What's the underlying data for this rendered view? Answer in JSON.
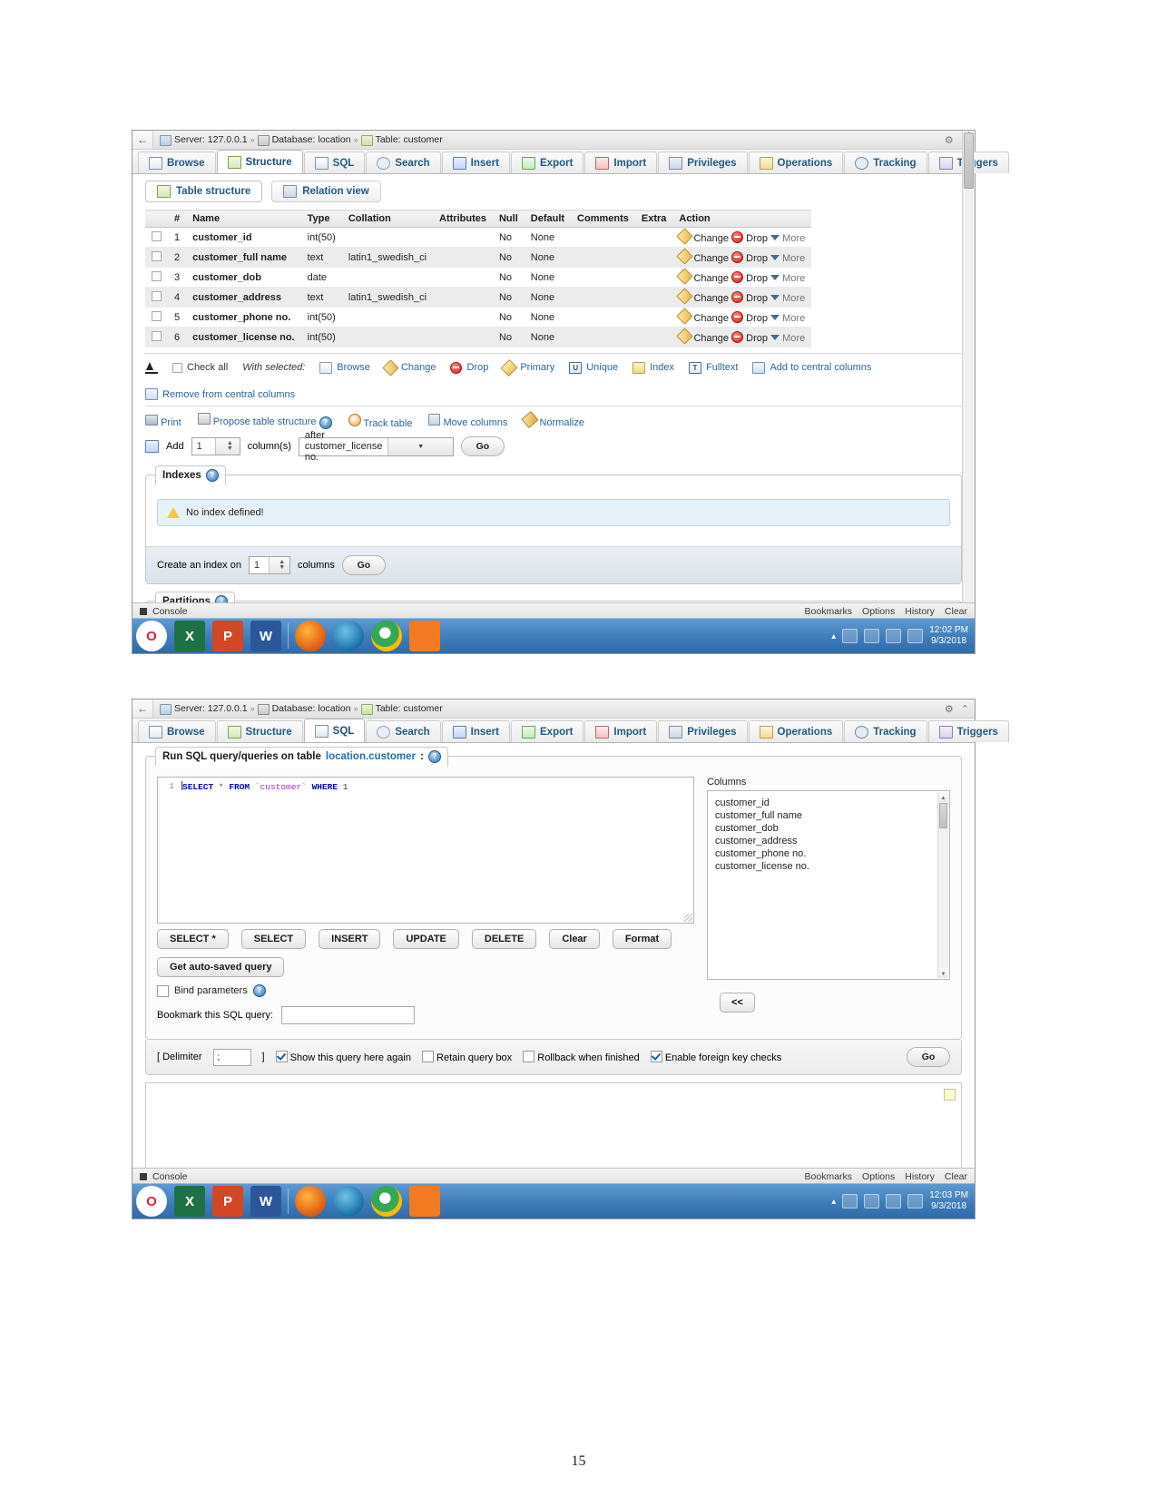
{
  "window1": {
    "breadcrumb": {
      "server": "Server: 127.0.0.1",
      "database": "Database: location",
      "table": "Table: customer",
      "sep": "»"
    },
    "tabs": [
      {
        "label": "Browse",
        "icon": "browse-icon"
      },
      {
        "label": "Structure",
        "icon": "structure-icon"
      },
      {
        "label": "SQL",
        "icon": "sql-icon"
      },
      {
        "label": "Search",
        "icon": "search-icon"
      },
      {
        "label": "Insert",
        "icon": "insert-icon"
      },
      {
        "label": "Export",
        "icon": "export-icon"
      },
      {
        "label": "Import",
        "icon": "import-icon"
      },
      {
        "label": "Privileges",
        "icon": "privileges-icon"
      },
      {
        "label": "Operations",
        "icon": "operations-icon"
      },
      {
        "label": "Tracking",
        "icon": "tracking-icon"
      },
      {
        "label": "Triggers",
        "icon": "triggers-icon"
      }
    ],
    "subtabs": [
      {
        "label": "Table structure"
      },
      {
        "label": "Relation view"
      }
    ],
    "table": {
      "headers": [
        "",
        "#",
        "Name",
        "Type",
        "Collation",
        "Attributes",
        "Null",
        "Default",
        "Comments",
        "Extra",
        "Action"
      ],
      "rows": [
        {
          "num": "1",
          "name": "customer_id",
          "type": "int(50)",
          "collation": "",
          "attributes": "",
          "null": "No",
          "default": "None",
          "comments": "",
          "extra": ""
        },
        {
          "num": "2",
          "name": "customer_full name",
          "type": "text",
          "collation": "latin1_swedish_ci",
          "attributes": "",
          "null": "No",
          "default": "None",
          "comments": "",
          "extra": ""
        },
        {
          "num": "3",
          "name": "customer_dob",
          "type": "date",
          "collation": "",
          "attributes": "",
          "null": "No",
          "default": "None",
          "comments": "",
          "extra": ""
        },
        {
          "num": "4",
          "name": "customer_address",
          "type": "text",
          "collation": "latin1_swedish_ci",
          "attributes": "",
          "null": "No",
          "default": "None",
          "comments": "",
          "extra": ""
        },
        {
          "num": "5",
          "name": "customer_phone no.",
          "type": "int(50)",
          "collation": "",
          "attributes": "",
          "null": "No",
          "default": "None",
          "comments": "",
          "extra": ""
        },
        {
          "num": "6",
          "name": "customer_license no.",
          "type": "int(50)",
          "collation": "",
          "attributes": "",
          "null": "No",
          "default": "None",
          "comments": "",
          "extra": ""
        }
      ],
      "action_labels": {
        "change": "Change",
        "drop": "Drop",
        "more": "More"
      }
    },
    "with_selected": {
      "check_all": "Check all",
      "label": "With selected:",
      "actions": [
        "Browse",
        "Change",
        "Drop",
        "Primary",
        "Unique",
        "Index",
        "Fulltext",
        "Add to central columns"
      ],
      "remove": "Remove from central columns"
    },
    "tools": [
      "Print",
      "Propose table structure",
      "Track table",
      "Move columns",
      "Normalize"
    ],
    "add_row": {
      "add": "Add",
      "count": "1",
      "columns": "column(s)",
      "position": "after customer_license no.",
      "go": "Go"
    },
    "indexes": {
      "legend": "Indexes",
      "no_index": "No index defined!",
      "create_label": "Create an index on",
      "count": "1",
      "columns": "columns",
      "go": "Go"
    },
    "partitions": {
      "legend": "Partitions"
    },
    "console": {
      "label": "Console",
      "links": [
        "Bookmarks",
        "Options",
        "History",
        "Clear"
      ]
    },
    "taskbar": {
      "time": "12:02 PM",
      "date": "9/3/2018"
    }
  },
  "window2": {
    "breadcrumb": {
      "server": "Server: 127.0.0.1",
      "database": "Database: location",
      "table": "Table: customer",
      "sep": "»"
    },
    "tabs": [
      {
        "label": "Browse",
        "icon": "browse-icon"
      },
      {
        "label": "Structure",
        "icon": "structure-icon"
      },
      {
        "label": "SQL",
        "icon": "sql-icon"
      },
      {
        "label": "Search",
        "icon": "search-icon"
      },
      {
        "label": "Insert",
        "icon": "insert-icon"
      },
      {
        "label": "Export",
        "icon": "export-icon"
      },
      {
        "label": "Import",
        "icon": "import-icon"
      },
      {
        "label": "Privileges",
        "icon": "privileges-icon"
      },
      {
        "label": "Operations",
        "icon": "operations-icon"
      },
      {
        "label": "Tracking",
        "icon": "tracking-icon"
      },
      {
        "label": "Triggers",
        "icon": "triggers-icon"
      }
    ],
    "panel_legend_prefix": "Run SQL query/queries on table ",
    "panel_legend_target": "location.customer",
    "panel_legend_suffix": ":",
    "editor": {
      "line_number": "1",
      "code_keyword1": "SELECT",
      "code_star": "*",
      "code_keyword2": "FROM",
      "code_table": "`customer`",
      "code_keyword3": "WHERE",
      "code_value": "1",
      "full_query": "SELECT * FROM `customer` WHERE 1"
    },
    "columns": {
      "label": "Columns",
      "items": [
        "customer_id",
        "customer_full name",
        "customer_dob",
        "customer_address",
        "customer_phone no.",
        "customer_license no."
      ]
    },
    "buttons": [
      "SELECT *",
      "SELECT",
      "INSERT",
      "UPDATE",
      "DELETE",
      "Clear",
      "Format"
    ],
    "autosaved_button": "Get auto-saved query",
    "bind_parameters": "Bind parameters",
    "bookmark_label": "Bookmark this SQL query:",
    "bookmark_value": "",
    "collapse_button": "<<",
    "options": {
      "delimiter_open": "[ Delimiter",
      "delimiter_value": ";",
      "delimiter_close": "]",
      "show_query": "Show this query here again",
      "retain_query": "Retain query box",
      "rollback": "Rollback when finished",
      "foreign_key": "Enable foreign key checks",
      "go": "Go"
    },
    "console": {
      "label": "Console",
      "links": [
        "Bookmarks",
        "Options",
        "History",
        "Clear"
      ]
    },
    "taskbar": {
      "time": "12:03 PM",
      "date": "9/3/2018"
    }
  },
  "taskbar_apps": [
    "O",
    "X",
    "P",
    "W",
    "firefox",
    "thunderbird",
    "chrome",
    "xampp"
  ],
  "page_number": "15",
  "colors": {
    "tab_text": "#235a81",
    "link": "#2a6496",
    "taskbar": "#3f7cb8",
    "notice_bg": "#e7f2f8"
  }
}
